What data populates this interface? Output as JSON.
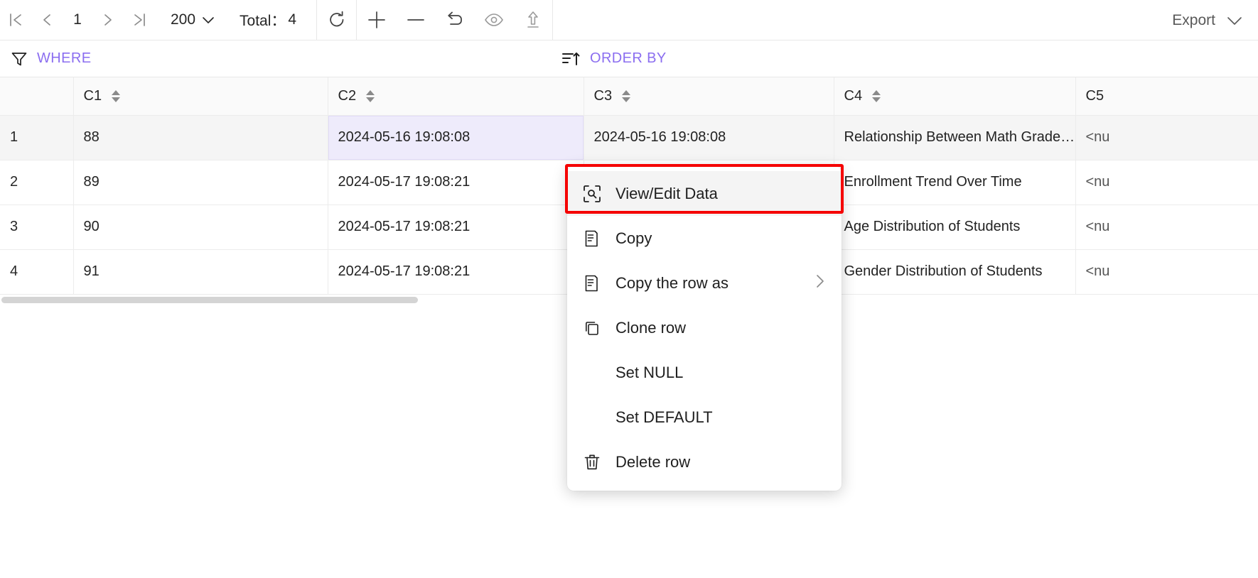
{
  "toolbar": {
    "nav": {
      "first_label": "first-page",
      "prev_label": "previous-page",
      "next_label": "next-page",
      "last_label": "last-page"
    },
    "page_number": "1",
    "page_size": "200",
    "total_label": "Total：",
    "total_value": "4",
    "actions": {
      "refresh": "refresh",
      "add_row": "add-row",
      "remove_row": "remove-row",
      "revert": "revert",
      "preview": "preview",
      "commit": "commit"
    },
    "export_label": "Export"
  },
  "filterbar": {
    "where_label": "WHERE",
    "order_by_label": "ORDER BY",
    "accent_color": "#8b6ef0"
  },
  "table": {
    "index_header": "",
    "columns": [
      {
        "key": "c1",
        "label": "C1"
      },
      {
        "key": "c2",
        "label": "C2"
      },
      {
        "key": "c3",
        "label": "C3"
      },
      {
        "key": "c4",
        "label": "C4"
      },
      {
        "key": "c5",
        "label": "C5"
      }
    ],
    "rows": [
      {
        "index": "1",
        "c1": "88",
        "c2": "2024-05-16 19:08:08",
        "c3": "2024-05-16 19:08:08",
        "c4": "Relationship Between Math Grade…",
        "c5": "<nu"
      },
      {
        "index": "2",
        "c1": "89",
        "c2": "2024-05-17 19:08:21",
        "c3": "",
        "c4": "Enrollment Trend Over Time",
        "c5": "<nu"
      },
      {
        "index": "3",
        "c1": "90",
        "c2": "2024-05-17 19:08:21",
        "c3": "",
        "c4": "Age Distribution of Students",
        "c5": "<nu"
      },
      {
        "index": "4",
        "c1": "91",
        "c2": "2024-05-17 19:08:21",
        "c3": "",
        "c4": "Gender Distribution of Students",
        "c5": "<nu"
      }
    ]
  },
  "context_menu": {
    "items": [
      {
        "label": "View/Edit Data",
        "icon": "scan-search-icon",
        "highlighted": true,
        "submenu": false
      },
      {
        "label": "Copy",
        "icon": "copy-document-icon",
        "highlighted": false,
        "submenu": false
      },
      {
        "label": "Copy the row as",
        "icon": "copy-document-icon",
        "highlighted": false,
        "submenu": true
      },
      {
        "label": "Clone row",
        "icon": "clone-icon",
        "highlighted": false,
        "submenu": false
      },
      {
        "label": "Set NULL",
        "icon": "",
        "highlighted": false,
        "submenu": false
      },
      {
        "label": "Set DEFAULT",
        "icon": "",
        "highlighted": false,
        "submenu": false
      },
      {
        "label": "Delete row",
        "icon": "trash-icon",
        "highlighted": false,
        "submenu": false
      }
    ],
    "highlight_outline_color": "#f50000"
  }
}
